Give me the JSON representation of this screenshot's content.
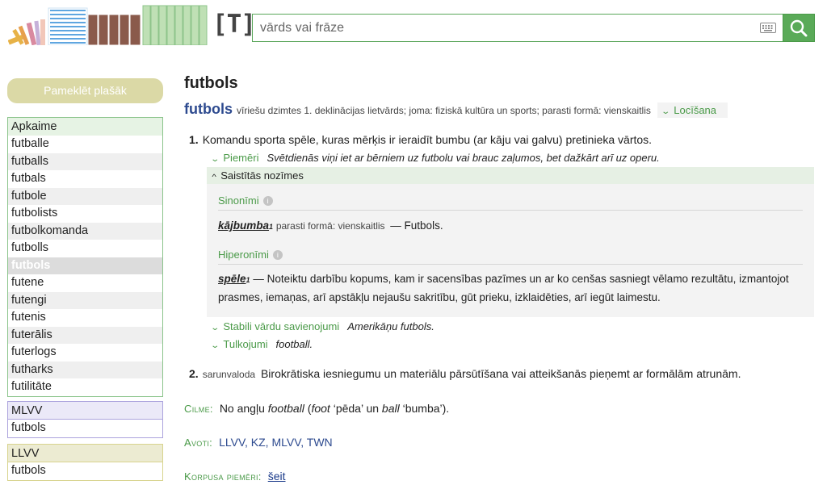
{
  "colors": {
    "accent_green": "#5aaa58",
    "headword_blue": "#2d4a8f",
    "sidebar_button": "#dbd9a6",
    "panel_green": "#8bc48b",
    "panel_purple": "#aca4dd",
    "panel_yellow": "#d8d48e"
  },
  "header": {
    "brand": "[T]:",
    "search_placeholder": "vārds vai frāze",
    "icons": [
      "books-logo",
      "keyboard-icon",
      "search-icon"
    ]
  },
  "sidebar": {
    "more_button": "Pameklēt plašāk",
    "neighborhood": {
      "title": "Apkaime",
      "items": [
        "futballe",
        "futballs",
        "futbals",
        "futbole",
        "futbolists",
        "futbolkomanda",
        "futbolls",
        "futbols",
        "futene",
        "futengi",
        "futenis",
        "futerālis",
        "futerlogs",
        "futharks",
        "futilitāte"
      ],
      "active": "futbols"
    },
    "mlvv": {
      "title": "MLVV",
      "items": [
        "futbols"
      ]
    },
    "llvv": {
      "title": "LLVV",
      "items": [
        "futbols"
      ]
    }
  },
  "entry": {
    "title": "futbols",
    "headword": "futbols",
    "grammar": "vīriešu dzimtes 1. deklinācijas lietvārds; joma: fiziskā kultūra un sports; parasti formā: vienskaitlis",
    "inflection_button": "Locīšana",
    "sense1": {
      "num": "1.",
      "text": "Komandu sporta spēle, kuras mērķis ir ieraidīt bumbu (ar kāju vai galvu) pretinieka vārtos.",
      "examples_label": "Piemēri",
      "example": "Svētdienās viņi iet ar bērniem uz futbolu vai brauc zaļumos, bet dažkārt arī uz operu.",
      "related_label": "Saistītās nozīmes",
      "synonyms_label": "Sinonīmi",
      "synonym_word": "kājbumba",
      "synonym_sub": "1",
      "synonym_gram": "parasti formā: vienskaitlis",
      "synonym_def": "— Futbols.",
      "hypernyms_label": "Hiperonīmi",
      "hypernym_word": "spēle",
      "hypernym_sub": "1",
      "hypernym_def1": "— Noteiktu darbību kopums, kam ir sacensības pazīmes un ar ko cenšas sasniegt vēlamo rezultātu, izmantojot",
      "hypernym_def2": "prasmes, iemaņas, arī apstākļu nejaušu sakritību, gūt prieku, izklaidēties, arī iegūt laimestu.",
      "collocations_label": "Stabili vārdu savienojumi",
      "collocation": "Amerikāņu futbols.",
      "translations_label": "Tulkojumi",
      "translation": "football."
    },
    "sense2": {
      "num": "2.",
      "register": "sarunvaloda",
      "text": "Birokrātiska iesniegumu un materiālu pārsūtīšana vai atteikšanās pieņemt ar formālām atrunām."
    },
    "etymology": {
      "label": "Cilme:",
      "p1": "No angļu ",
      "w1": "football",
      "p2": " (",
      "w2": "foot",
      "p3": " ‘pēda’ un ",
      "w3": "ball",
      "p4": " ‘bumba’)."
    },
    "sources": {
      "label": "Avoti:",
      "text": "LLVV, KZ, MLVV, TWN"
    },
    "corpus": {
      "label": "Korpusa piemēri:",
      "link": "šeit"
    }
  }
}
